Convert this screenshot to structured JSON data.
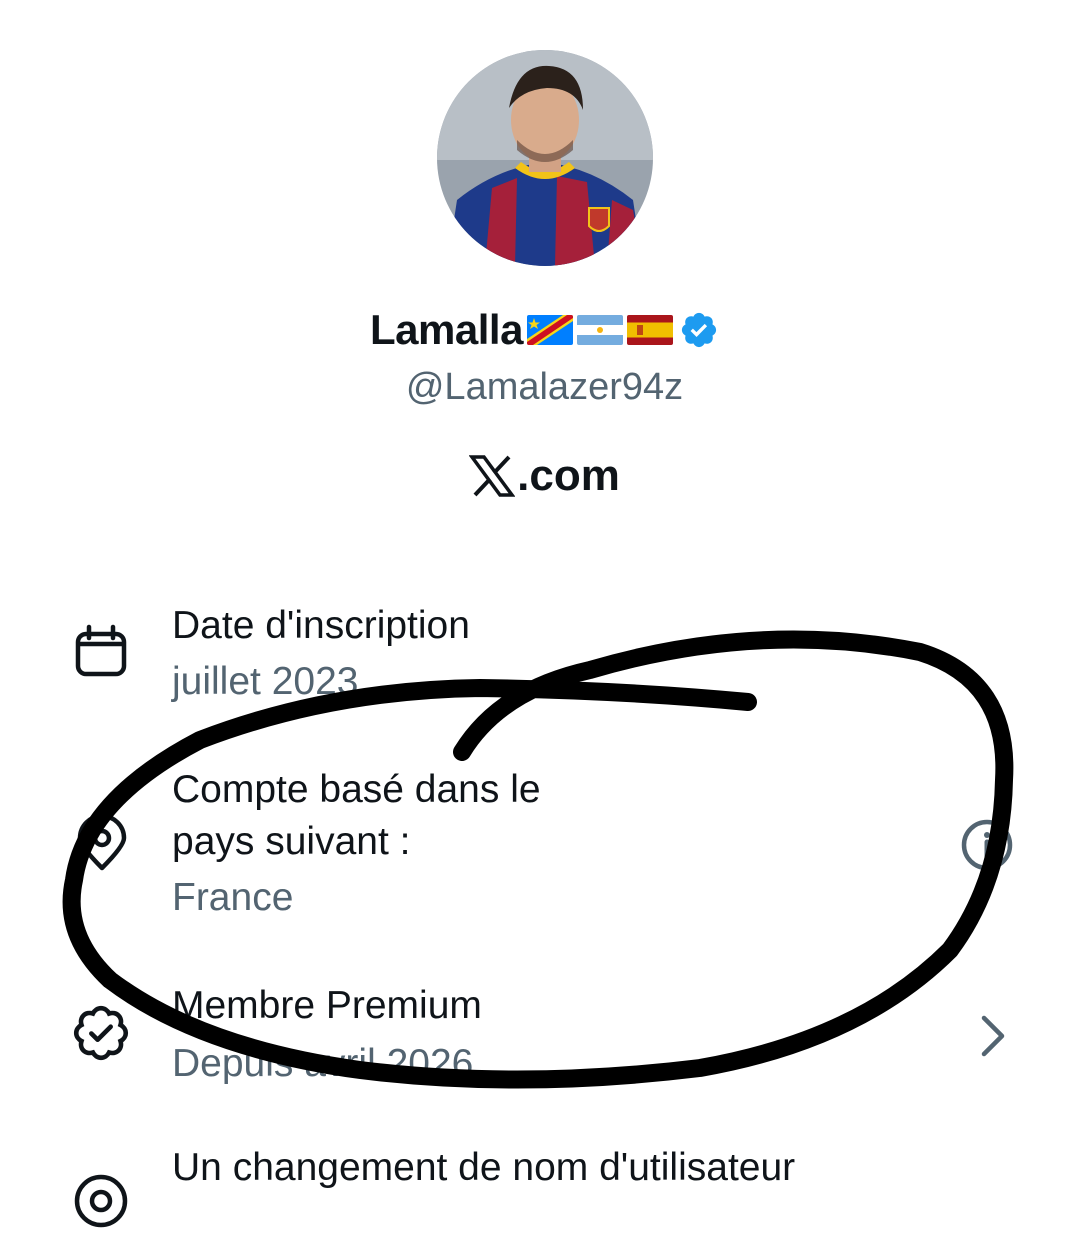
{
  "profile": {
    "display_name": "Lamalla",
    "flags": [
      "flag-dr-congo-icon",
      "flag-argentina-icon",
      "flag-spain-icon"
    ],
    "verified": true,
    "handle": "@Lamalazer94z",
    "site": ".com"
  },
  "about": {
    "joined": {
      "label": "Date d'inscription",
      "value": "juillet 2023",
      "icon": "calendar-icon"
    },
    "country": {
      "label_line1": "Compte basé dans le",
      "label_line2": "pays suivant :",
      "value": "France",
      "icon": "location-pin-icon",
      "action_icon": "info-icon"
    },
    "premium": {
      "label": "Membre Premium",
      "value": "Depuis avril 2026",
      "icon": "verified-badge-icon",
      "action_icon": "chevron-right-icon"
    },
    "username_change": {
      "label": "Un changement de nom d'utilisateur",
      "icon": "at-sign-icon"
    }
  },
  "colors": {
    "text_primary": "#0f1419",
    "text_secondary": "#536471",
    "verified_blue": "#1d9bf0",
    "annotation_ink": "#000000"
  }
}
